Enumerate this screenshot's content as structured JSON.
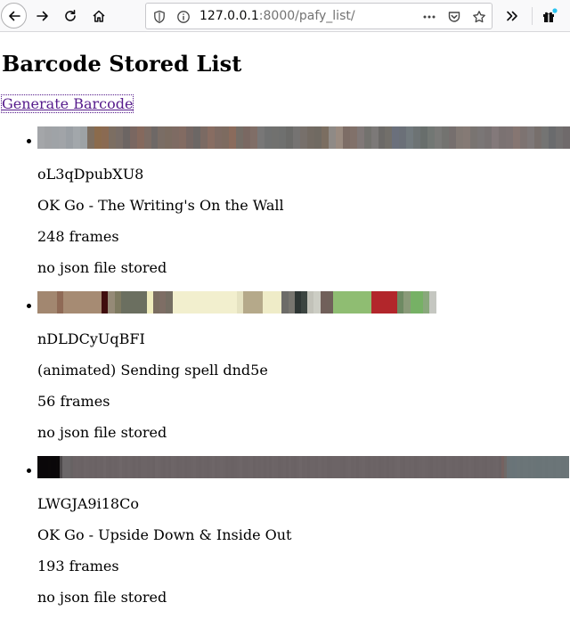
{
  "browser": {
    "url_host": "127.0.0.1",
    "url_rest": ":8000/pafy_list/"
  },
  "page": {
    "title": "Barcode Stored List",
    "generate_link": "Generate Barcode"
  },
  "items": [
    {
      "id": "oL3qDpubXU8",
      "title": "OK Go - The Writing's On the Wall",
      "frames": "248 frames",
      "json_status": "no json file stored",
      "barcode_colors": [
        "#a4a6a9",
        "#a0a2a5",
        "#9fa3a7",
        "#a1a4a8",
        "#9a9fa4",
        "#a2a7ab",
        "#9da2a5",
        "#7d6e5f",
        "#8b6b4c",
        "#8a6a52",
        "#7c6e62",
        "#786d67",
        "#6c6563",
        "#7a6761",
        "#85695d",
        "#7c6c64",
        "#6e6866",
        "#7a6d65",
        "#7b6c61",
        "#7e6b63",
        "#826b62",
        "#756763",
        "#6c6765",
        "#7b6a63",
        "#886d62",
        "#7e6b63",
        "#7d6b60",
        "#8a6b5c",
        "#756d66",
        "#7a6862",
        "#806e67",
        "#787777",
        "#707171",
        "#71716f",
        "#6f706f",
        "#6b6b69",
        "#757372",
        "#77706b",
        "#736b63",
        "#706a62",
        "#7b6e61",
        "#8f8a86",
        "#9a8b80",
        "#7d6d66",
        "#81716a",
        "#807877",
        "#73726e",
        "#7c7978",
        "#6c6a68",
        "#726f6a",
        "#6b707c",
        "#6b7078",
        "#727a7e",
        "#6d7374",
        "#686e6c",
        "#727774",
        "#7a7a78",
        "#737370",
        "#766f6e",
        "#827974",
        "#857a75",
        "#797471",
        "#7a7676",
        "#787272",
        "#83797a",
        "#7b7272",
        "#7d7373",
        "#867672",
        "#7d7371",
        "#7e7878",
        "#776f6c",
        "#747473",
        "#6a6b6d",
        "#727070",
        "#6f6a6b"
      ]
    },
    {
      "id": "nDLDCyUqBFI",
      "title": "(animated) Sending spell dnd5e",
      "frames": "56 frames",
      "json_status": "no json file stored",
      "barcode_colors": [
        "#a28770",
        "#a28770",
        "#a28770",
        "#8f6a56",
        "#a68b73",
        "#a68b73",
        "#a68b73",
        "#a68b73",
        "#a68b73",
        "#a68b73",
        "#400d0e",
        "#958a77",
        "#7e7a61",
        "#6b6f60",
        "#6b6f60",
        "#6b6f60",
        "#6b6f60",
        "#efecbd",
        "#7a6d60",
        "#7e6e65",
        "#756e63",
        "#f2efce",
        "#f2efce",
        "#f2efce",
        "#f2efce",
        "#f2efce",
        "#f2efce",
        "#f2efce",
        "#f2efce",
        "#f2efce",
        "#f2efce",
        "#e5e2c1",
        "#b5a98a",
        "#b5a98a",
        "#b5a98a",
        "#efecc8",
        "#efecc8",
        "#efecc8",
        "#6d6c68",
        "#77756f",
        "#2e3634",
        "#3c4541",
        "#c2c2b9",
        "#cccdc4",
        "#71605a",
        "#70615a",
        "#8fbd72",
        "#8fbd72",
        "#8fbd72",
        "#8fbd72",
        "#8fbd72",
        "#8fbd72",
        "#b2262b",
        "#b2262b",
        "#b2262b",
        "#b2262b",
        "#6e8a63",
        "#8a9a79",
        "#76b165",
        "#76b165",
        "#89a87c",
        "#c5c7c1"
      ]
    },
    {
      "id": "LWGJA9i18Co",
      "title": "OK Go - Upside Down & Inside Out",
      "frames": "193 frames",
      "json_status": "no json file stored",
      "barcode_colors": [
        "#0d0a0c",
        "#0a0709",
        "#0a0709",
        "#0a0709",
        "#0b0809",
        "#0a0709",
        "#0a0709",
        "#0b0809",
        "#4e4a4c",
        "#6b6769",
        "#6b6769",
        "#6b6769",
        "#676263",
        "#6b6365",
        "#6c6466",
        "#6b6365",
        "#6a6264",
        "#6d6567",
        "#6c6466",
        "#6b6365",
        "#6c6466",
        "#6a6264",
        "#6c6466",
        "#6b6365",
        "#6e6668",
        "#6b6365",
        "#6a6264",
        "#6c6466",
        "#6b6365",
        "#6c6466",
        "#6f6769",
        "#6c6466",
        "#6b6365",
        "#6d6567",
        "#6c6466",
        "#6a6264",
        "#6c6466",
        "#6a6264",
        "#6c6466",
        "#6c6466",
        "#6b6365",
        "#6c6466",
        "#6a6264",
        "#6e6668",
        "#6d6567",
        "#6b6365",
        "#6a6264",
        "#6c6466",
        "#6a6264",
        "#6d6567",
        "#6c6466",
        "#6a6264",
        "#6b6365",
        "#6c6466",
        "#6a6264",
        "#6b6365",
        "#6c6466",
        "#6d6567",
        "#6b6365",
        "#6a6264",
        "#6c6466",
        "#6b6365",
        "#6a6264",
        "#6c6466",
        "#6e6668",
        "#6b6365",
        "#6c6466",
        "#6d6567",
        "#6c6466",
        "#6a6264",
        "#6b6365",
        "#6a6264",
        "#6b6365",
        "#6c6466",
        "#6e6668",
        "#6b6365",
        "#6b6365",
        "#6c6466",
        "#6d6567",
        "#6a6264",
        "#6c6466",
        "#6b6365",
        "#6c6466",
        "#6a6264",
        "#6c6466",
        "#6a6264",
        "#6d6567",
        "#6c6466",
        "#6a6264",
        "#6b6365",
        "#6c6466",
        "#6a6264",
        "#6d6567",
        "#6b6365",
        "#6a6264",
        "#6c6466",
        "#6e6668",
        "#6b6365",
        "#6c6466",
        "#6a6264",
        "#6c6466",
        "#6c6466",
        "#6b6365",
        "#6d6567",
        "#6b6365",
        "#6c6466",
        "#6a6264",
        "#6b6365",
        "#6c6466",
        "#6c6466",
        "#6c6466",
        "#6b6365",
        "#6a6264",
        "#6c6466",
        "#6d6567",
        "#6b6365",
        "#6c6466",
        "#6a6264",
        "#6c6466",
        "#6d6567",
        "#6b6365",
        "#6a6264",
        "#6c6466",
        "#6b6365",
        "#6c6466",
        "#6a6264",
        "#6b6365",
        "#6c6466",
        "#6a6264",
        "#6c6466",
        "#6b6365",
        "#6d6567",
        "#6e6668",
        "#6b6365",
        "#6a6264",
        "#6c6466",
        "#6b6365",
        "#6c6466",
        "#6a6264",
        "#6b6365",
        "#6c6466",
        "#6d6567",
        "#6c6466",
        "#6b6365",
        "#6a6264",
        "#6c6466",
        "#6b6365",
        "#6c6466",
        "#6b6365",
        "#6a6264",
        "#6d6567",
        "#6c6466",
        "#6b6365",
        "#6c6466",
        "#6b6365",
        "#6a6264",
        "#6c6466",
        "#6b6365",
        "#6d6567",
        "#6c6466",
        "#6a6264",
        "#6b6365",
        "#6c6466",
        "#6b6365",
        "#6a6264",
        "#6c6466",
        "#6b6365",
        "#6c6466",
        "#6d6567",
        "#6a6264",
        "#756260",
        "#6f6a68",
        "#6b7376",
        "#6a7478",
        "#697478",
        "#6a7479",
        "#6b7578",
        "#6a7477",
        "#6b7578",
        "#6b7578",
        "#6a7477",
        "#6b7578",
        "#6a7477",
        "#697477",
        "#6a7477",
        "#6b7578",
        "#6a7477",
        "#6b7578",
        "#6b7578",
        "#6a7477",
        "#6b7578",
        "#6b7578",
        "#6a7477",
        "#6a7477",
        "#6b7578"
      ]
    }
  ]
}
